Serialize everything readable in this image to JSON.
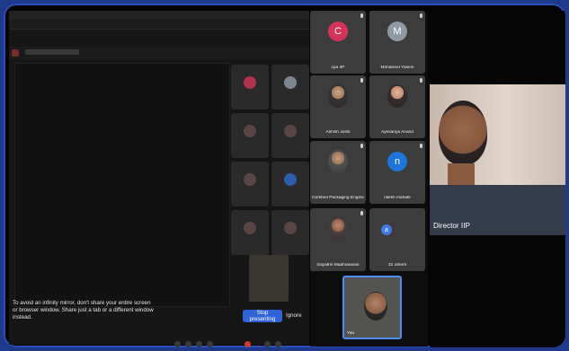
{
  "shared_screen": {
    "notice_text": "To avoid an infinity mirror, don't share your entire screen or browser window. Share just a tab or a different window instead.",
    "stop_presenting_label": "Stop presenting",
    "ignore_label": "Ignore"
  },
  "participants": [
    {
      "name": "cpa IIP",
      "avatar_letter": "C",
      "avatar_color": "#d6335a",
      "type": "letter"
    },
    {
      "name": "Mohamed Yasein",
      "avatar_letter": "M",
      "avatar_color": "#8f9aa5",
      "type": "letter"
    },
    {
      "name": "Ashish Joshi",
      "type": "photo"
    },
    {
      "name": "Ayesanya Anand",
      "type": "photo"
    },
    {
      "name": "Certified Packaging Engineers",
      "type": "photo"
    },
    {
      "name": "nilesh mahale",
      "avatar_letter": "n",
      "avatar_color": "#1e74d8",
      "type": "letter"
    },
    {
      "name": "Gayathri Madhuwaran",
      "type": "photo"
    },
    {
      "name": "31 others",
      "type": "others"
    }
  ],
  "self_tile": {
    "label": "You"
  },
  "speaker": {
    "name": "Director IIP"
  },
  "colors": {
    "accent_blue": "#2f63d6",
    "frame_blue": "#1f3a8a",
    "tile_bg": "#3c3c3c"
  }
}
